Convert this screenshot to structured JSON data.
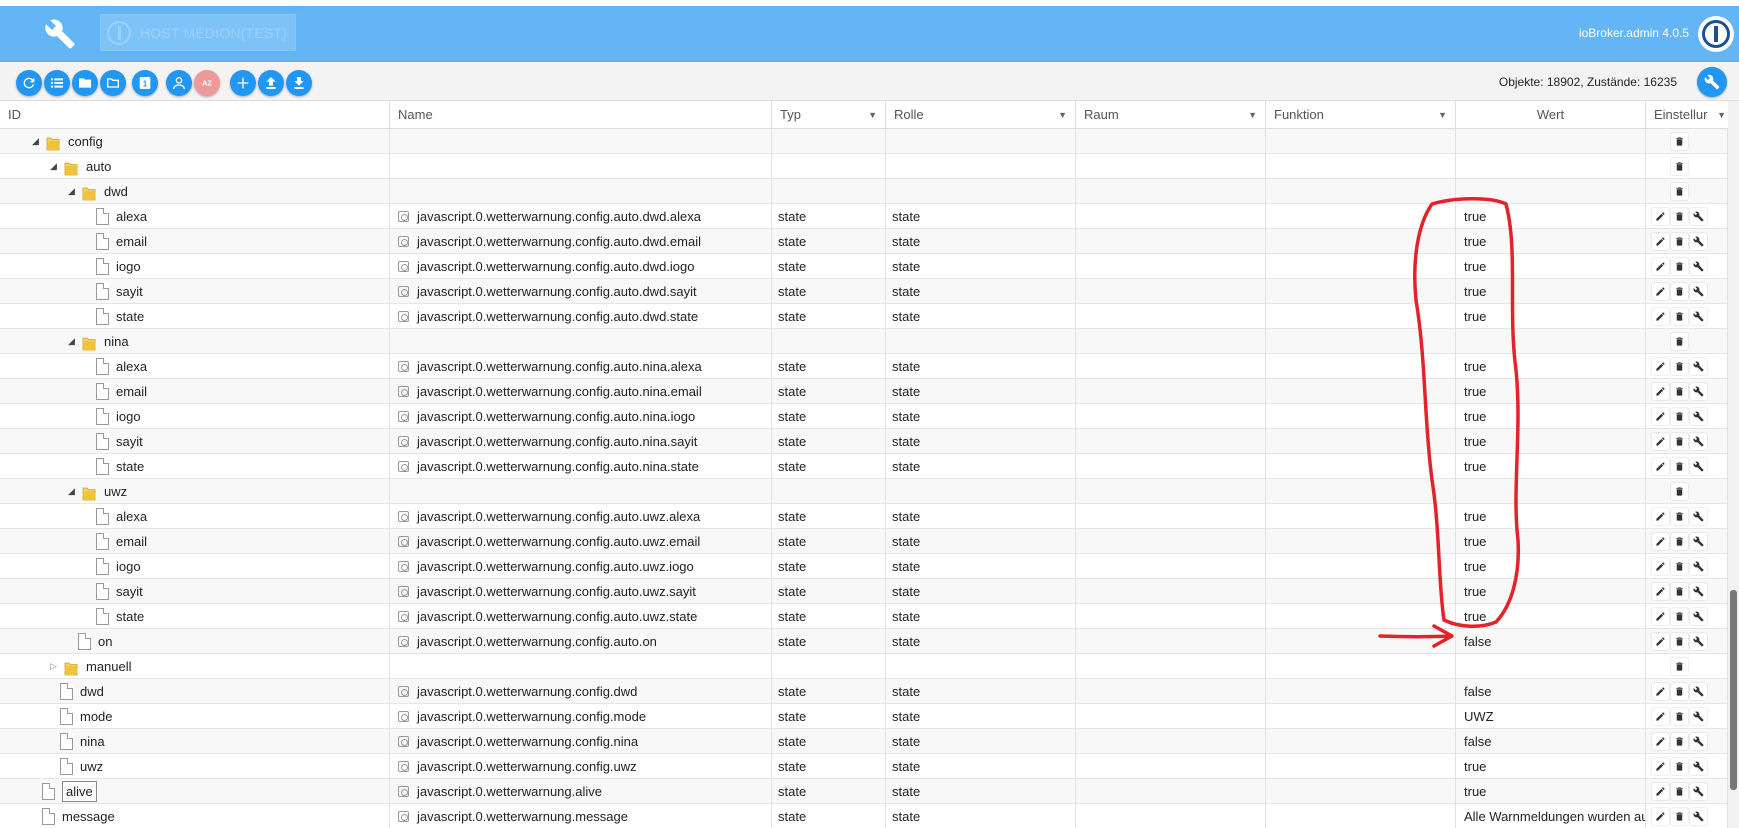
{
  "header": {
    "host_name": "HOST MEDION(TEST)",
    "version": "ioBroker.admin 4.0.5"
  },
  "toolbar": {
    "buttons": [
      {
        "icon": "refresh-icon"
      },
      {
        "icon": "list-icon"
      },
      {
        "icon": "folder-open-icon"
      },
      {
        "icon": "folder-icon"
      },
      {
        "icon": "number-one-icon",
        "text": "1"
      },
      {
        "icon": "user-icon"
      },
      {
        "icon": "sort-az-icon",
        "text": "AZ"
      },
      {
        "icon": "add-icon"
      },
      {
        "icon": "upload-icon"
      },
      {
        "icon": "download-icon"
      }
    ],
    "counter": "Objekte: 18902, Zustände: 16235"
  },
  "columns": {
    "id": "ID",
    "name": "Name",
    "typ": "Typ",
    "rolle": "Rolle",
    "raum": "Raum",
    "funktion": "Funktion",
    "wert": "Wert",
    "einstellungen": "Einstellur"
  },
  "rows": [
    {
      "kind": "folder",
      "level": 1,
      "id": "config",
      "open": true
    },
    {
      "kind": "folder",
      "level": 2,
      "id": "auto",
      "open": true
    },
    {
      "kind": "folder",
      "level": 3,
      "id": "dwd",
      "open": true
    },
    {
      "kind": "state",
      "level": 4,
      "id": "alexa",
      "name": "javascript.0.wetterwarnung.config.auto.dwd.alexa",
      "typ": "state",
      "rolle": "state",
      "wert": "true"
    },
    {
      "kind": "state",
      "level": 4,
      "id": "email",
      "name": "javascript.0.wetterwarnung.config.auto.dwd.email",
      "typ": "state",
      "rolle": "state",
      "wert": "true"
    },
    {
      "kind": "state",
      "level": 4,
      "id": "iogo",
      "name": "javascript.0.wetterwarnung.config.auto.dwd.iogo",
      "typ": "state",
      "rolle": "state",
      "wert": "true"
    },
    {
      "kind": "state",
      "level": 4,
      "id": "sayit",
      "name": "javascript.0.wetterwarnung.config.auto.dwd.sayit",
      "typ": "state",
      "rolle": "state",
      "wert": "true"
    },
    {
      "kind": "state",
      "level": 4,
      "id": "state",
      "name": "javascript.0.wetterwarnung.config.auto.dwd.state",
      "typ": "state",
      "rolle": "state",
      "wert": "true"
    },
    {
      "kind": "folder",
      "level": 3,
      "id": "nina",
      "open": true
    },
    {
      "kind": "state",
      "level": 4,
      "id": "alexa",
      "name": "javascript.0.wetterwarnung.config.auto.nina.alexa",
      "typ": "state",
      "rolle": "state",
      "wert": "true"
    },
    {
      "kind": "state",
      "level": 4,
      "id": "email",
      "name": "javascript.0.wetterwarnung.config.auto.nina.email",
      "typ": "state",
      "rolle": "state",
      "wert": "true"
    },
    {
      "kind": "state",
      "level": 4,
      "id": "iogo",
      "name": "javascript.0.wetterwarnung.config.auto.nina.iogo",
      "typ": "state",
      "rolle": "state",
      "wert": "true"
    },
    {
      "kind": "state",
      "level": 4,
      "id": "sayit",
      "name": "javascript.0.wetterwarnung.config.auto.nina.sayit",
      "typ": "state",
      "rolle": "state",
      "wert": "true"
    },
    {
      "kind": "state",
      "level": 4,
      "id": "state",
      "name": "javascript.0.wetterwarnung.config.auto.nina.state",
      "typ": "state",
      "rolle": "state",
      "wert": "true"
    },
    {
      "kind": "folder",
      "level": 3,
      "id": "uwz",
      "open": true
    },
    {
      "kind": "state",
      "level": 4,
      "id": "alexa",
      "name": "javascript.0.wetterwarnung.config.auto.uwz.alexa",
      "typ": "state",
      "rolle": "state",
      "wert": "true"
    },
    {
      "kind": "state",
      "level": 4,
      "id": "email",
      "name": "javascript.0.wetterwarnung.config.auto.uwz.email",
      "typ": "state",
      "rolle": "state",
      "wert": "true"
    },
    {
      "kind": "state",
      "level": 4,
      "id": "iogo",
      "name": "javascript.0.wetterwarnung.config.auto.uwz.iogo",
      "typ": "state",
      "rolle": "state",
      "wert": "true"
    },
    {
      "kind": "state",
      "level": 4,
      "id": "sayit",
      "name": "javascript.0.wetterwarnung.config.auto.uwz.sayit",
      "typ": "state",
      "rolle": "state",
      "wert": "true"
    },
    {
      "kind": "state",
      "level": 4,
      "id": "state",
      "name": "javascript.0.wetterwarnung.config.auto.uwz.state",
      "typ": "state",
      "rolle": "state",
      "wert": "true"
    },
    {
      "kind": "state",
      "level": 3,
      "id": "on",
      "name": "javascript.0.wetterwarnung.config.auto.on",
      "typ": "state",
      "rolle": "state",
      "wert": "false"
    },
    {
      "kind": "folder",
      "level": 2,
      "id": "manuell",
      "open": false
    },
    {
      "kind": "state",
      "level": 2,
      "id": "dwd",
      "name": "javascript.0.wetterwarnung.config.dwd",
      "typ": "state",
      "rolle": "state",
      "wert": "false"
    },
    {
      "kind": "state",
      "level": 2,
      "id": "mode",
      "name": "javascript.0.wetterwarnung.config.mode",
      "typ": "state",
      "rolle": "state",
      "wert": "UWZ"
    },
    {
      "kind": "state",
      "level": 2,
      "id": "nina",
      "name": "javascript.0.wetterwarnung.config.nina",
      "typ": "state",
      "rolle": "state",
      "wert": "false"
    },
    {
      "kind": "state",
      "level": 2,
      "id": "uwz",
      "name": "javascript.0.wetterwarnung.config.uwz",
      "typ": "state",
      "rolle": "state",
      "wert": "true"
    },
    {
      "kind": "state",
      "level": 1,
      "id": "alive",
      "name": "javascript.0.wetterwarnung.alive",
      "typ": "state",
      "rolle": "state",
      "wert": "true",
      "selected": true
    },
    {
      "kind": "state",
      "level": 1,
      "id": "message",
      "name": "javascript.0.wetterwarnung.message",
      "typ": "state",
      "rolle": "state",
      "wert": "Alle Warnmeldungen wurden au"
    }
  ],
  "colors": {
    "header": "#64b5f6",
    "button": "#2196f3",
    "button_pink": "#ef9a9a",
    "annotation": "#e3232c"
  }
}
